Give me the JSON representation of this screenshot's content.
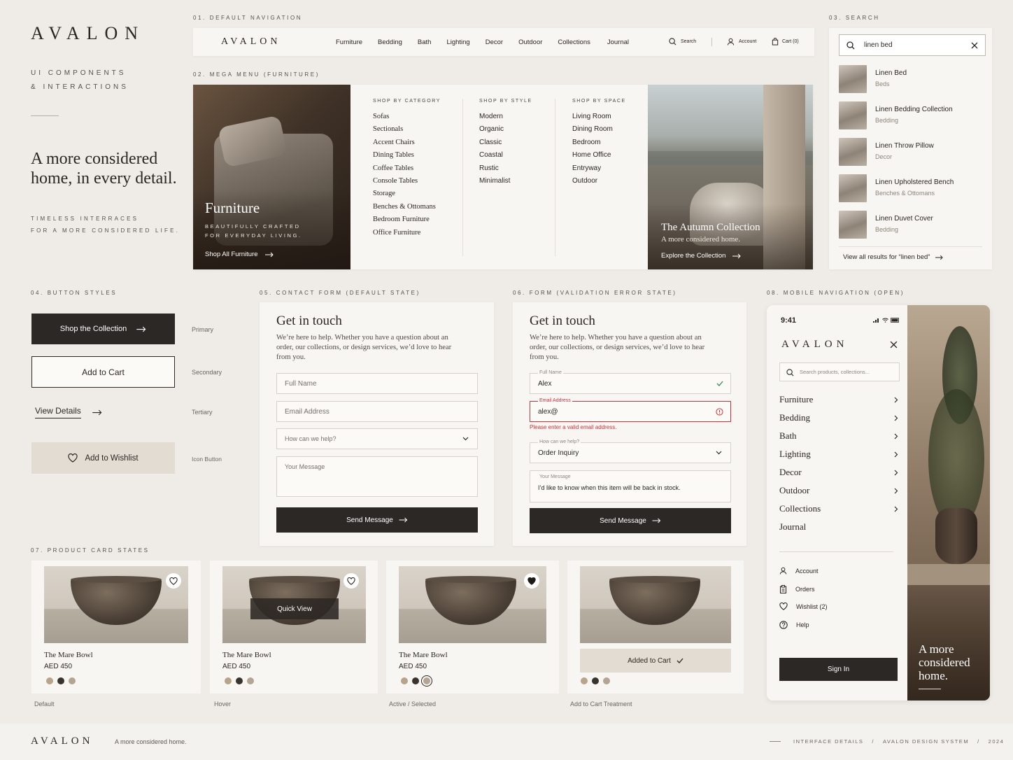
{
  "intro": {
    "logo": "AVALON",
    "subtitle_1": "UI COMPONENTS",
    "subtitle_2": "& INTERACTIONS",
    "headline_1": "A more considered",
    "headline_2": "home, in every detail.",
    "tagline_1": "TIMELESS INTERRACES",
    "tagline_2": "FOR A MORE CONSIDERED LIFE."
  },
  "sections": {
    "nav": "01. DEFAULT NAVIGATION",
    "mega": "02. MEGA MENU (FURNITURE)",
    "search": "03. SEARCH",
    "buttons": "04. BUTTON STYLES",
    "contact": "05. CONTACT FORM (DEFAULT STATE)",
    "error": "06. FORM (VALIDATION ERROR STATE)",
    "mobile": "08. MOBILE NAVIGATION (OPEN)",
    "products": "07. PRODUCT CARD STATES"
  },
  "nav": {
    "logo": "AVALON",
    "links": [
      "Furniture",
      "Bedding",
      "Bath",
      "Lighting",
      "Decor",
      "Outdoor",
      "Collections",
      "Journal"
    ],
    "search": "Search",
    "account": "Account",
    "cart": "Cart (0)"
  },
  "mega": {
    "hero_title": "Furniture",
    "hero_sub_1": "BEAUTIFULLY CRAFTED",
    "hero_sub_2": "FOR EVERYDAY LIVING.",
    "hero_link": "Shop All Furniture",
    "cat_heading": "SHOP BY CATEGORY",
    "categories": [
      "Sofas",
      "Sectionals",
      "Accent Chairs",
      "Dining Tables",
      "Coffee Tables",
      "Console Tables",
      "Storage",
      "Benches & Ottomans",
      "Bedroom Furniture",
      "Office Furniture"
    ],
    "style_heading": "SHOP BY STYLE",
    "styles": [
      "Modern",
      "Organic",
      "Classic",
      "Coastal",
      "Rustic",
      "Minimalist"
    ],
    "space_heading": "SHOP BY SPACE",
    "spaces": [
      "Living Room",
      "Dining Room",
      "Bedroom",
      "Home Office",
      "Entryway",
      "Outdoor"
    ],
    "promo_title": "The Autumn Collection",
    "promo_sub": "A more considered home.",
    "promo_link": "Explore the Collection"
  },
  "search": {
    "query": "linen bed",
    "results": [
      {
        "title": "Linen Bed",
        "category": "Beds"
      },
      {
        "title": "Linen Bedding Collection",
        "category": "Bedding"
      },
      {
        "title": "Linen Throw Pillow",
        "category": "Decor"
      },
      {
        "title": "Linen Upholstered Bench",
        "category": "Benches & Ottomans"
      },
      {
        "title": "Linen Duvet Cover",
        "category": "Bedding"
      }
    ],
    "view_all": "View all results for “linen bed”"
  },
  "buttons": {
    "primary": "Shop the Collection",
    "primary_cap": "Primary",
    "secondary": "Add to Cart",
    "secondary_cap": "Secondary",
    "tertiary": "View Details",
    "tertiary_cap": "Tertiary",
    "icon": "Add to Wishlist",
    "icon_cap": "Icon Button"
  },
  "contact": {
    "title": "Get in touch",
    "desc": "We’re here to help. Whether you have a question about an order, our collections, or design services, we’d love to hear from you.",
    "name_ph": "Full Name",
    "email_ph": "Email Address",
    "help_ph": "How can we help?",
    "message_ph": "Your Message",
    "send": "Send Message"
  },
  "error_form": {
    "title": "Get in touch",
    "desc": "We’re here to help. Whether you have a question about an order, our collections, or design services, we’d love to hear from you.",
    "name_label": "Full Name",
    "name_value": "Alex",
    "email_label": "Email Address",
    "email_value": "alex@",
    "email_error": "Please enter a valid email address.",
    "help_label": "How can we help?",
    "help_value": "Order Inquiry",
    "message_label": "Your Message",
    "message_value": "I’d like to know when this item will be back in stock.",
    "send": "Send Message",
    "error_color": "#c8323a",
    "ok_color": "#3c8a4e"
  },
  "mobile": {
    "time": "9:41",
    "logo": "AVALON",
    "search_ph": "Search products, collections...",
    "items": [
      "Furniture",
      "Bedding",
      "Bath",
      "Lighting",
      "Decor",
      "Outdoor",
      "Collections",
      "Journal"
    ],
    "account": "Account",
    "orders": "Orders",
    "wishlist": "Wishlist (2)",
    "help": "Help",
    "sign_in": "Sign In",
    "hero_1": "A more",
    "hero_2": "considered",
    "hero_3": "home."
  },
  "products": {
    "name": "The Mare Bowl",
    "price": "AED 450",
    "quick_view": "Quick View",
    "added": "Added to Cart",
    "captions": [
      "Default",
      "Hover",
      "Active / Selected",
      "Add to Cart Treatment"
    ],
    "swatches": [
      "#b7a48a",
      "#3a332d",
      "#b3a592"
    ]
  },
  "footer": {
    "logo": "AVALON",
    "tagline": "A more considered home.",
    "c1": "INTERFACE DETAILS",
    "c2": "AVALON DESIGN SYSTEM",
    "c3": "2024",
    "sep": "/"
  }
}
